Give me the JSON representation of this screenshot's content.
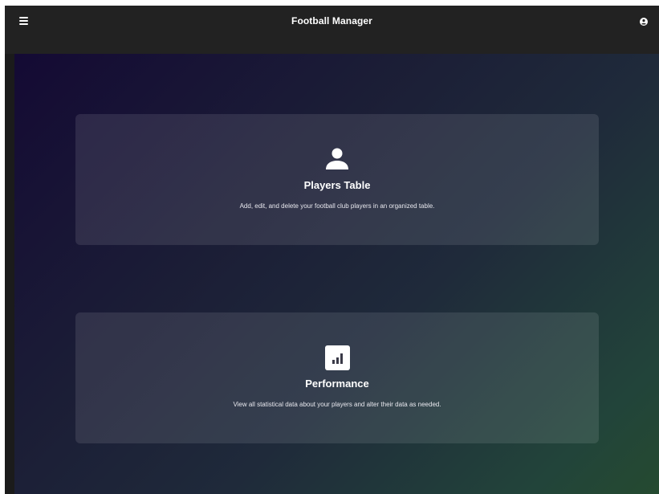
{
  "header": {
    "title": "Football Manager",
    "menu_icon": "hamburger-menu-icon",
    "account_icon": "account-circle-icon"
  },
  "cards": [
    {
      "icon": "person-icon",
      "title": "Players Table",
      "description": "Add, edit, and delete your football club players in an organized table."
    },
    {
      "icon": "bar-chart-icon",
      "title": "Performance",
      "description": "View all statistical data about your players and alter their data as needed."
    }
  ],
  "colors": {
    "topbar": "#222222",
    "card_text": "#ffffff",
    "gradient_start": "#140a34",
    "gradient_end": "#254a30"
  }
}
